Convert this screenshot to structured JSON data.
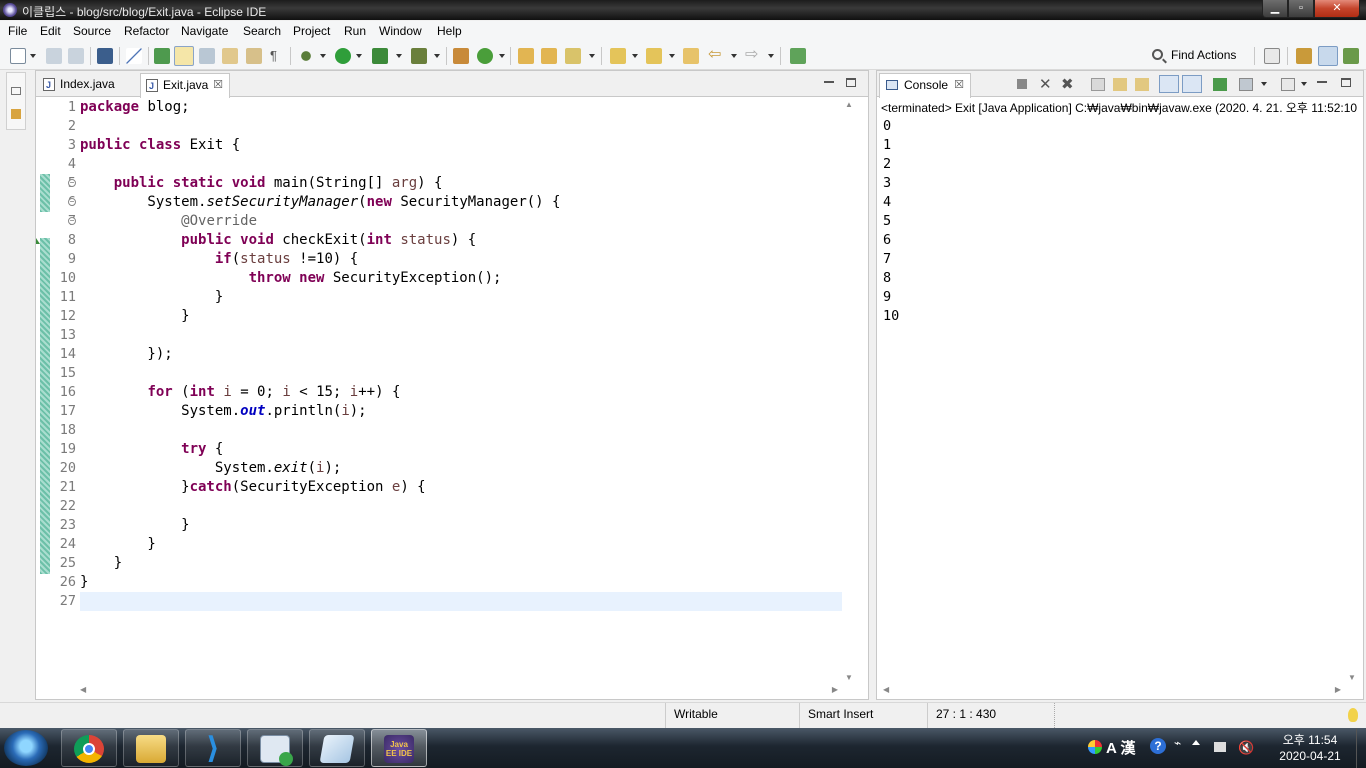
{
  "window": {
    "title": "이클립스 - blog/src/blog/Exit.java - Eclipse IDE"
  },
  "menubar": [
    "File",
    "Edit",
    "Source",
    "Refactor",
    "Navigate",
    "Search",
    "Project",
    "Run",
    "Window",
    "Help"
  ],
  "toolbar": {
    "find_actions": "Find Actions"
  },
  "editor": {
    "tabs": [
      {
        "label": "Index.java",
        "active": false
      },
      {
        "label": "Exit.java",
        "active": true,
        "close": "☒"
      }
    ],
    "line_numbers": [
      "1",
      "2",
      "3",
      "4",
      "5",
      "6",
      "7",
      "8",
      "9",
      "10",
      "11",
      "12",
      "13",
      "14",
      "15",
      "16",
      "17",
      "18",
      "19",
      "20",
      "21",
      "22",
      "23",
      "24",
      "25",
      "26",
      "27"
    ]
  },
  "console": {
    "tab_label": "Console",
    "description": "<terminated> Exit [Java Application] C:₩java₩bin₩javaw.exe  (2020. 4. 21. 오후 11:52:10",
    "output": [
      "0",
      "1",
      "2",
      "3",
      "4",
      "5",
      "6",
      "7",
      "8",
      "9",
      "10"
    ]
  },
  "statusbar": {
    "writable": "Writable",
    "insert_mode": "Smart Insert",
    "position": "27 : 1 : 430"
  },
  "taskbar": {
    "apps": [
      {
        "name": "chrome"
      },
      {
        "name": "file-explorer"
      },
      {
        "name": "vscode"
      },
      {
        "name": "app-launcher"
      },
      {
        "name": "notepad"
      },
      {
        "name": "eclipse",
        "label": "Java EE IDE",
        "active": true
      }
    ],
    "clock_time": "오후 11:54",
    "clock_date": "2020-04-21",
    "ime": "A 漢"
  },
  "colors": {
    "keyword": "#7f0055",
    "annotation": "#646464",
    "field": "#0000c0",
    "current_line": "#e8f2fe"
  }
}
